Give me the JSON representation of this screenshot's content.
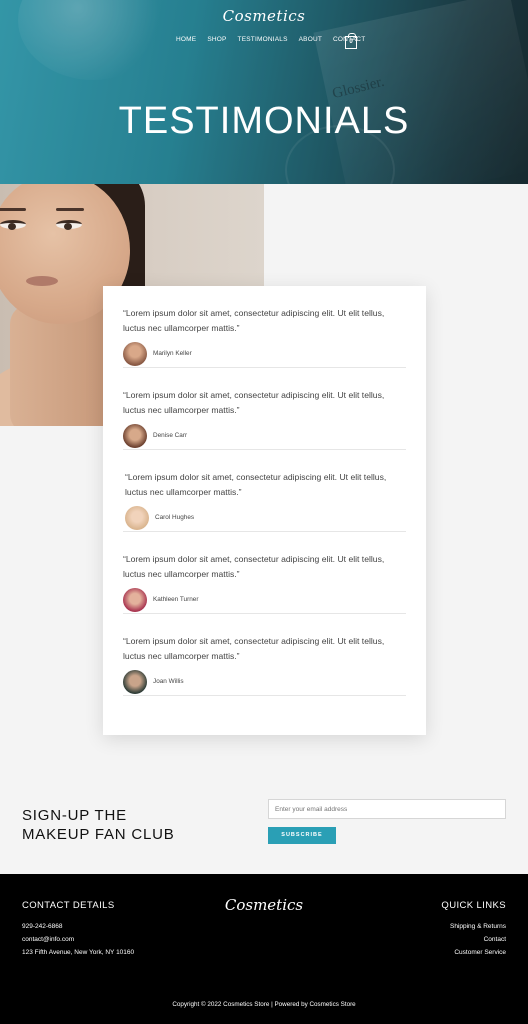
{
  "brand": {
    "logo_text": "Cosmetics"
  },
  "nav": {
    "items": [
      "HOME",
      "SHOP",
      "TESTIMONIALS",
      "ABOUT",
      "CONTACT"
    ],
    "cart_count": "0"
  },
  "hero": {
    "title": "TESTIMONIALS",
    "product_text": "Glossier."
  },
  "testimonials": [
    {
      "quote": "“Lorem ipsum dolor sit amet, consectetur adipiscing elit. Ut elit tellus, luctus nec ullamcorper mattis.”",
      "name": "Marilyn Keller",
      "avatar_color": "#8a5a45"
    },
    {
      "quote": "“Lorem ipsum dolor sit amet, consectetur adipiscing elit. Ut elit tellus, luctus nec ullamcorper mattis.”",
      "name": "Denise Carr",
      "avatar_color": "#6b3f2e"
    },
    {
      "quote": "“Lorem ipsum dolor sit amet, consectetur adipiscing elit. Ut elit tellus, luctus nec ullamcorper mattis.”",
      "name": "Carol Hughes",
      "avatar_color": "#d9b48e"
    },
    {
      "quote": "“Lorem ipsum dolor sit amet, consectetur adipiscing elit. Ut elit tellus, luctus nec ullamcorper mattis.”",
      "name": "Kathleen Turner",
      "avatar_color": "#a8334f"
    },
    {
      "quote": "“Lorem ipsum dolor sit amet, consectetur adipiscing elit. Ut elit tellus, luctus nec ullamcorper mattis.”",
      "name": "Joan Willis",
      "avatar_color": "#2c3b36"
    }
  ],
  "signup": {
    "title_line1": "SIGN-UP THE",
    "title_line2": "MAKEUP FAN CLUB",
    "email_placeholder": "Enter your email address",
    "button_label": "SUBSCRIBE"
  },
  "footer": {
    "contact_heading": "CONTACT DETAILS",
    "phone": "929-242-6868",
    "email": "contact@info.com",
    "address": "123 Fifth Avenue, New York, NY 10160",
    "logo_text": "Cosmetics",
    "quick_links_heading": "QUICK LINKS",
    "quick_links": [
      "Shipping & Returns",
      "Contact",
      "Customer Service"
    ],
    "copyright": "Copyright © 2022 Cosmetics Store | Powered by Cosmetics Store"
  },
  "colors": {
    "accent": "#2a9fb5",
    "footer_bg": "#000000",
    "hero_teal": "#2b8c9e"
  }
}
